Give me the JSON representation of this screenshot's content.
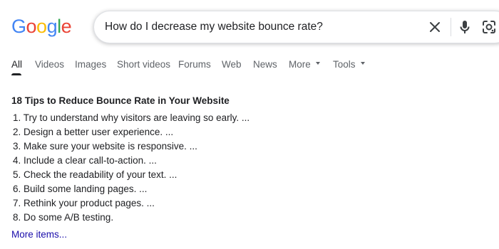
{
  "logo": {
    "letters": [
      "G",
      "o",
      "o",
      "g",
      "l",
      "e"
    ],
    "colors": [
      "#4285F4",
      "#EA4335",
      "#FBBC05",
      "#4285F4",
      "#34A853",
      "#EA4335"
    ]
  },
  "search": {
    "query": "How do I decrease my website bounce rate?",
    "icons": [
      "close-icon",
      "microphone-icon",
      "google-lens-icon"
    ]
  },
  "tabs": [
    {
      "label": "All",
      "active": true
    },
    {
      "label": "Videos",
      "active": false
    },
    {
      "label": "Images",
      "active": false
    },
    {
      "label": "Short videos",
      "active": false
    },
    {
      "label": "Forums",
      "active": false
    },
    {
      "label": "Web",
      "active": false
    },
    {
      "label": "News",
      "active": false
    },
    {
      "label": "More",
      "active": false,
      "has_caret": true
    },
    {
      "label": "Tools",
      "active": false,
      "has_caret": true
    }
  ],
  "snippet": {
    "title": "18 Tips to Reduce Bounce Rate in Your Website",
    "items": [
      "1. Try to understand why visitors are leaving so early. ...",
      "2. Design a better user experience. ...",
      "3. Make sure your website is responsive. ...",
      "4. Include a clear call-to-action. ...",
      "5. Check the readability of your text. ...",
      "6. Build some landing pages. ...",
      "7. Rethink your product pages. ...",
      "8. Do some A/B testing."
    ],
    "more_link": "More items..."
  },
  "colors": {
    "text": "#202124",
    "secondary": "#5f6368",
    "link": "#1a0dab"
  }
}
